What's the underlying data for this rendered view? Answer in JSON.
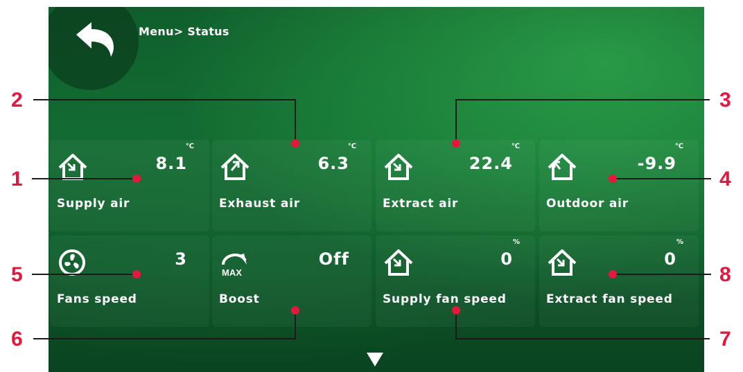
{
  "header": {
    "breadcrumb": "Menu> Status"
  },
  "tiles": [
    {
      "label": "Supply air",
      "value": "8.1",
      "unit": "℃",
      "icon": "house-arrow-in-icon"
    },
    {
      "label": "Exhaust air",
      "value": "6.3",
      "unit": "℃",
      "icon": "house-arrow-out-icon"
    },
    {
      "label": "Extract air",
      "value": "22.4",
      "unit": "℃",
      "icon": "house-arrow-in-icon"
    },
    {
      "label": "Outdoor air",
      "value": "-9.9",
      "unit": "℃",
      "icon": "house-arrow-out-icon"
    },
    {
      "label": "Fans speed",
      "value": "3",
      "unit": "",
      "icon": "fan-icon"
    },
    {
      "label": "Boost",
      "value": "Off",
      "unit": "",
      "icon": "max-gauge-icon"
    },
    {
      "label": "Supply fan speed",
      "value": "0",
      "unit": "%",
      "icon": "house-arrow-in-icon"
    },
    {
      "label": "Extract fan speed",
      "value": "0",
      "unit": "%",
      "icon": "house-arrow-in-icon"
    }
  ],
  "icons": {
    "max_text": "MAX"
  },
  "callouts": [
    "1",
    "2",
    "3",
    "4",
    "5",
    "6",
    "7",
    "8"
  ],
  "colors": {
    "callout": "#e5173f",
    "background": "#0f5e2c"
  }
}
